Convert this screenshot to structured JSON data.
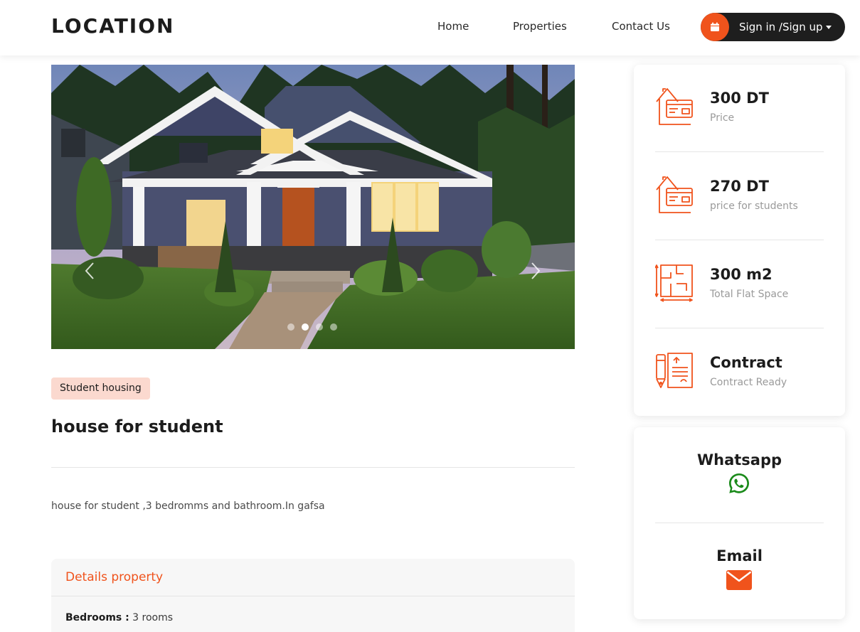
{
  "header": {
    "logo": "LOCATION",
    "nav": [
      {
        "label": "Home"
      },
      {
        "label": "Properties"
      },
      {
        "label": "Contact Us"
      }
    ],
    "signin_label": "Sign in /Sign up",
    "colors": {
      "accent": "#f0531c",
      "button_bg": "#1e1e1e"
    }
  },
  "carousel": {
    "slide_count": 4,
    "active_index": 1
  },
  "property": {
    "tag": "Student housing",
    "title": "house for student",
    "description": "house for student ,3 bedromms and bathroom.In gafsa"
  },
  "details": {
    "heading": "Details property",
    "rows": [
      {
        "key": "Bedrooms :",
        "value": " 3 rooms"
      }
    ]
  },
  "info": [
    {
      "icon": "house-card-icon",
      "value": "300 DT",
      "label": "Price"
    },
    {
      "icon": "house-card-icon",
      "value": "270 DT",
      "label": "price for students"
    },
    {
      "icon": "floor-plan-icon",
      "value": "300 m2",
      "label": "Total Flat Space"
    },
    {
      "icon": "contract-pen-icon",
      "value": "Contract",
      "label": "Contract Ready"
    }
  ],
  "contact": [
    {
      "label": "Whatsapp",
      "icon": "whatsapp-icon",
      "color": "#1a8a1a"
    },
    {
      "label": "Email",
      "icon": "envelope-icon",
      "color": "#f0531c"
    }
  ]
}
